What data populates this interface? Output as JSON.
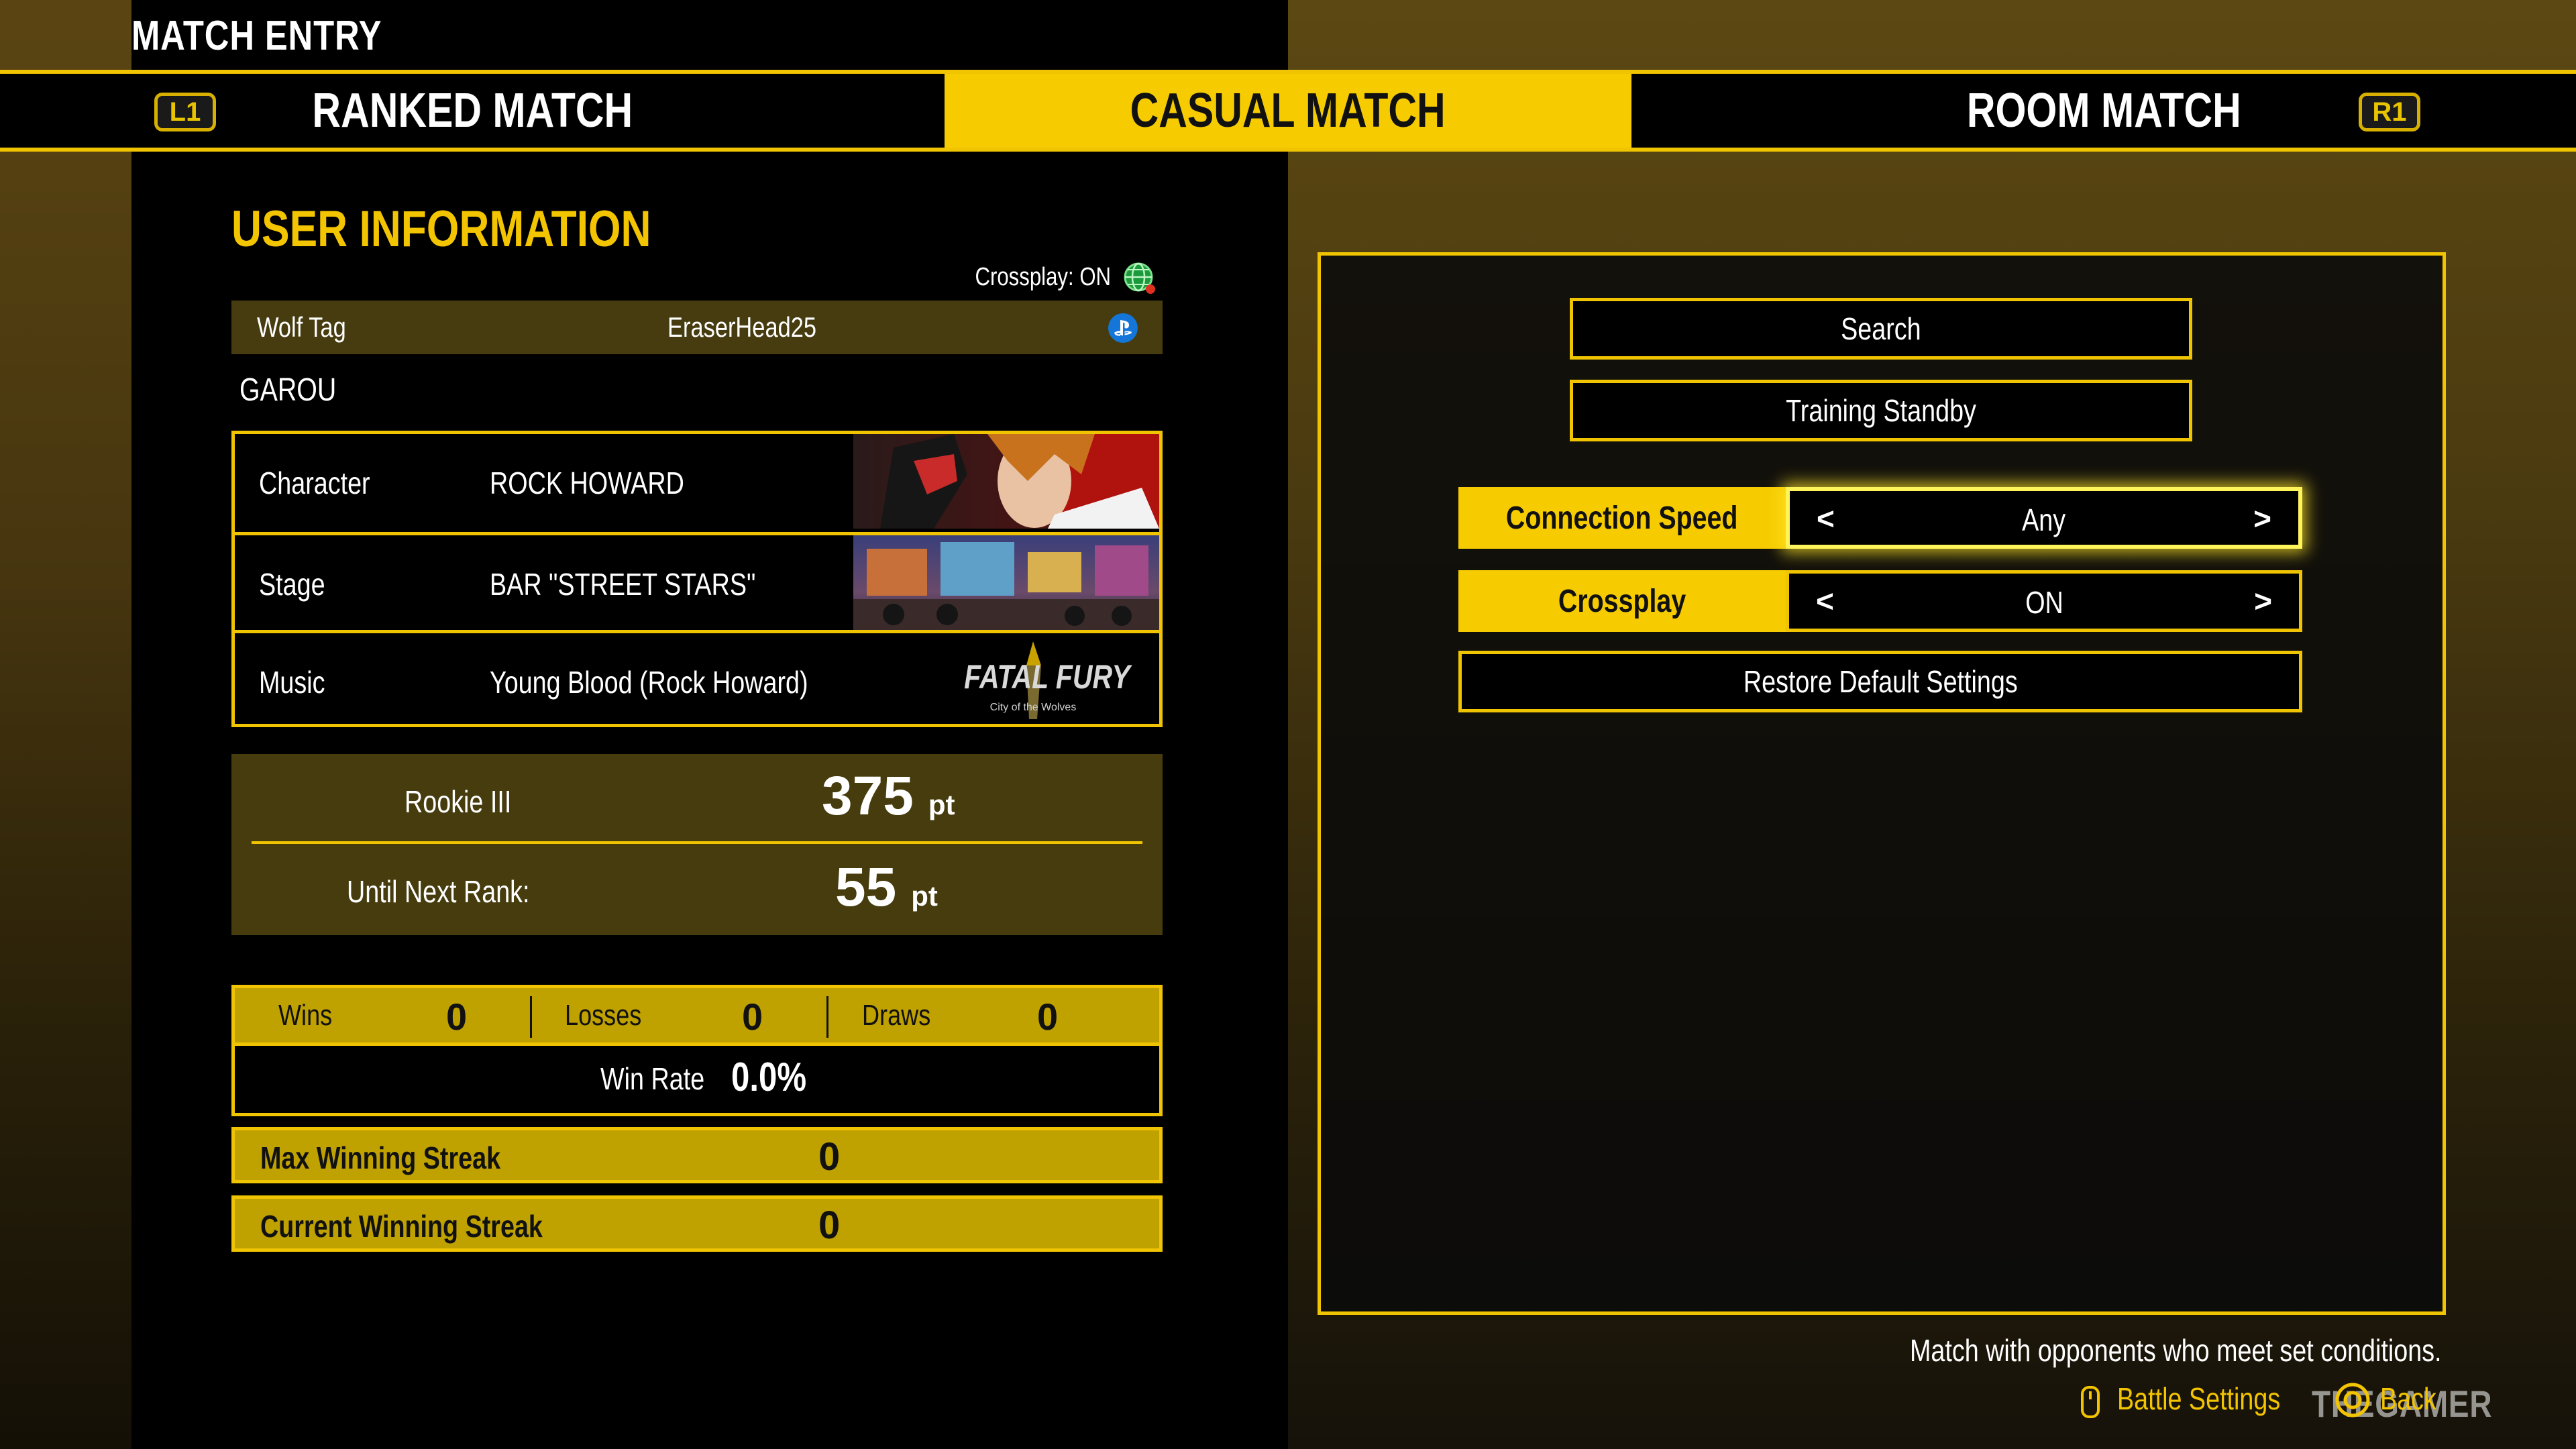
{
  "header": {
    "title": "MATCH ENTRY"
  },
  "tabs": {
    "left_button": "L1",
    "right_button": "R1",
    "items": [
      {
        "label": "RANKED MATCH",
        "selected": false
      },
      {
        "label": "CASUAL MATCH",
        "selected": true
      },
      {
        "label": "ROOM MATCH",
        "selected": false
      }
    ]
  },
  "user_info": {
    "title": "USER INFORMATION",
    "crossplay_status": "Crossplay: ON",
    "wolf_tag_label": "Wolf Tag",
    "wolf_tag_value": "EraserHead25",
    "platform_icon": "playstation-icon",
    "game_name": "GAROU",
    "loadout": [
      {
        "label": "Character",
        "value": "ROCK HOWARD",
        "thumbnail": "rock-howard-portrait"
      },
      {
        "label": "Stage",
        "value": "BAR \"STREET STARS\"",
        "thumbnail": "bar-street-stars-stage"
      },
      {
        "label": "Music",
        "value": "Young Blood (Rock Howard)",
        "thumbnail": "fatal-fury-logo"
      }
    ],
    "logo_text": "FATAL FURY",
    "logo_subtitle": "City of the Wolves",
    "rank": {
      "name": "Rookie III",
      "points": "375",
      "points_unit": "pt",
      "next_label": "Until Next Rank:",
      "next_points": "55",
      "next_unit": "pt"
    },
    "record": {
      "wins_label": "Wins",
      "wins": "0",
      "losses_label": "Losses",
      "losses": "0",
      "draws_label": "Draws",
      "draws": "0",
      "win_rate_label": "Win Rate",
      "win_rate": "0.0%"
    },
    "max_streak_label": "Max Winning Streak",
    "max_streak": "0",
    "current_streak_label": "Current Winning Streak",
    "current_streak": "0"
  },
  "settings": {
    "search_label": "Search",
    "training_label": "Training Standby",
    "connection_speed_label": "Connection Speed",
    "connection_speed_value": "Any",
    "crossplay_label": "Crossplay",
    "crossplay_value": "ON",
    "arrow_left": "<",
    "arrow_right": ">",
    "restore_label": "Restore Default Settings"
  },
  "footer": {
    "hint": "Match with opponents who meet set conditions.",
    "battle_settings_label": "Battle Settings",
    "back_label": "Back",
    "watermark": "THEGAMER"
  },
  "colors": {
    "accent": "#f6cc00",
    "panel": "#000000",
    "rank_bg": "#463c0e",
    "stat_bg": "#bfa100"
  }
}
